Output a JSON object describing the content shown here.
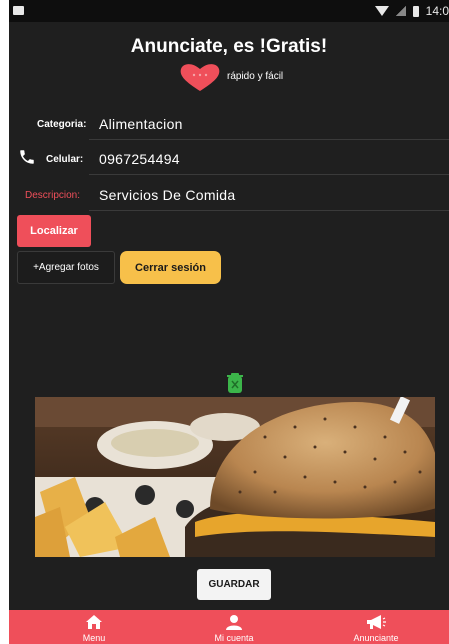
{
  "statusbar": {
    "time": "14:0"
  },
  "header": {
    "title": "Anunciate, es !Gratis!",
    "tagline": "rápido y fácil"
  },
  "form": {
    "categoria": {
      "label": "Categoria:",
      "value": "Alimentacion"
    },
    "celular": {
      "label": "Celular:",
      "value": "0967254494"
    },
    "descripcion": {
      "label": "Descripcion:",
      "value": "Servicios De Comida"
    }
  },
  "buttons": {
    "localizar": "Localizar",
    "agregar_fotos": "+Agregar fotos",
    "cerrar_sesion": "Cerrar sesión",
    "guardar": "GUARDAR"
  },
  "photo": {
    "subject": "hamburguesa con papas fritas"
  },
  "bottom_nav": [
    {
      "label": "Menu",
      "icon": "home-icon"
    },
    {
      "label": "Mi cuenta",
      "icon": "user-icon"
    },
    {
      "label": "Anunciante",
      "icon": "megaphone-icon"
    }
  ],
  "colors": {
    "accent": "#ef4f5a",
    "logout": "#f7c04a",
    "background": "#1f1f1f",
    "descripcion_label": "#ef4f5a",
    "trash": "#3cb54a"
  }
}
